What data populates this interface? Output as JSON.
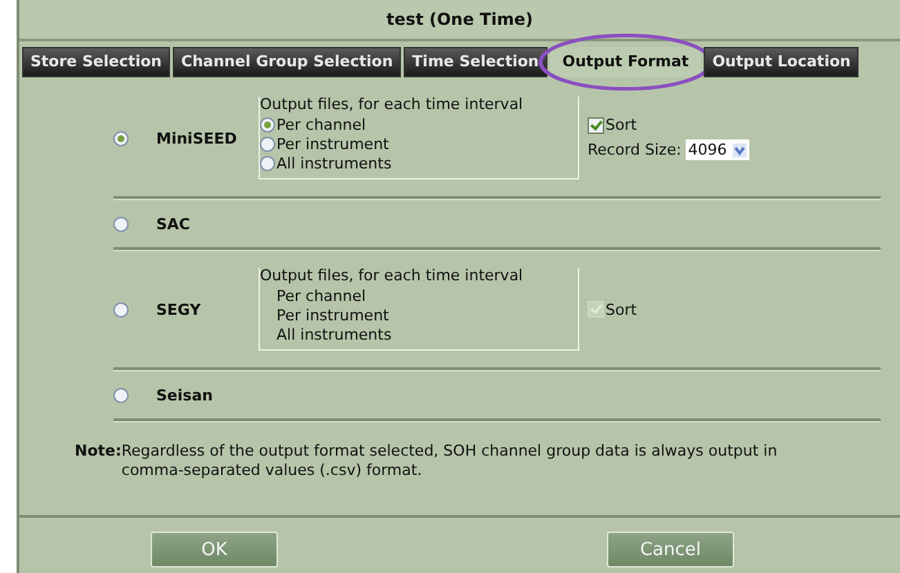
{
  "window": {
    "title": "test (One Time)"
  },
  "tabs": [
    {
      "label": "Store Selection",
      "selected": false
    },
    {
      "label": "Channel Group Selection",
      "selected": false
    },
    {
      "label": "Time Selection",
      "selected": false
    },
    {
      "label": "Output Format",
      "selected": true,
      "circled": true
    },
    {
      "label": "Output Location",
      "selected": false
    }
  ],
  "formats": [
    {
      "name": "MiniSEED",
      "selected": true,
      "kind": "options",
      "group": {
        "legend": "Output files, for each time interval",
        "options": [
          {
            "label": "Per channel",
            "selected": true
          },
          {
            "label": "Per instrument",
            "selected": false
          },
          {
            "label": "All instruments",
            "selected": false
          }
        ]
      },
      "sort": {
        "label": "Sort",
        "checked": true,
        "disabled": false
      },
      "record_size": {
        "label": "Record Size:",
        "value": "4096"
      }
    },
    {
      "name": "SAC",
      "selected": false,
      "kind": "plain"
    },
    {
      "name": "SEGY",
      "selected": false,
      "kind": "options",
      "group": {
        "legend": "Output files, for each time interval",
        "options": [
          {
            "label": "Per channel"
          },
          {
            "label": "Per instrument"
          },
          {
            "label": "All instruments"
          }
        ]
      },
      "sort": {
        "label": "Sort",
        "checked": true,
        "disabled": true
      }
    },
    {
      "name": "Seisan",
      "selected": false,
      "kind": "plain"
    }
  ],
  "note": {
    "label": "Note:",
    "text": "Regardless of the output format selected, SOH channel group data is always output in comma-separated values (.csv) format."
  },
  "buttons": [
    "OK",
    "Cancel"
  ]
}
